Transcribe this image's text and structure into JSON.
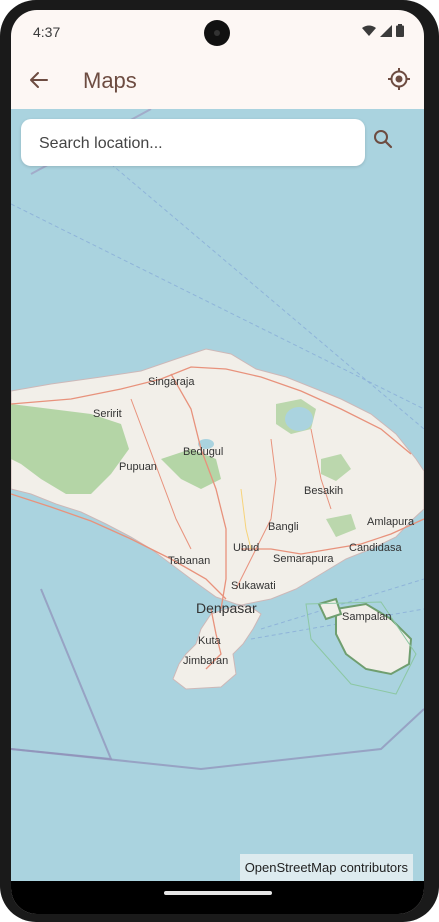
{
  "status_bar": {
    "time": "4:37",
    "icons": [
      "wifi-icon",
      "signal-icon",
      "battery-icon"
    ]
  },
  "app_bar": {
    "title": "Maps",
    "back_icon": "arrow-back-icon",
    "locate_icon": "my-location-icon"
  },
  "search": {
    "placeholder": "Search location...",
    "value": "",
    "icon": "search-icon"
  },
  "map": {
    "places": [
      "Singaraja",
      "Seririt",
      "Bedugul",
      "Pupuan",
      "Besakih",
      "Bangli",
      "Amlapura",
      "Candidasa",
      "Ubud",
      "Semarapura",
      "Tabanan",
      "Sukawati",
      "Denpasar",
      "Sampalan",
      "Kuta",
      "Jimbaran"
    ],
    "attribution": "OpenStreetMap contributors",
    "colors": {
      "water": "#aad3df",
      "land": "#f2efe9",
      "forest": "#add19e",
      "roads": "#e8927c"
    }
  }
}
